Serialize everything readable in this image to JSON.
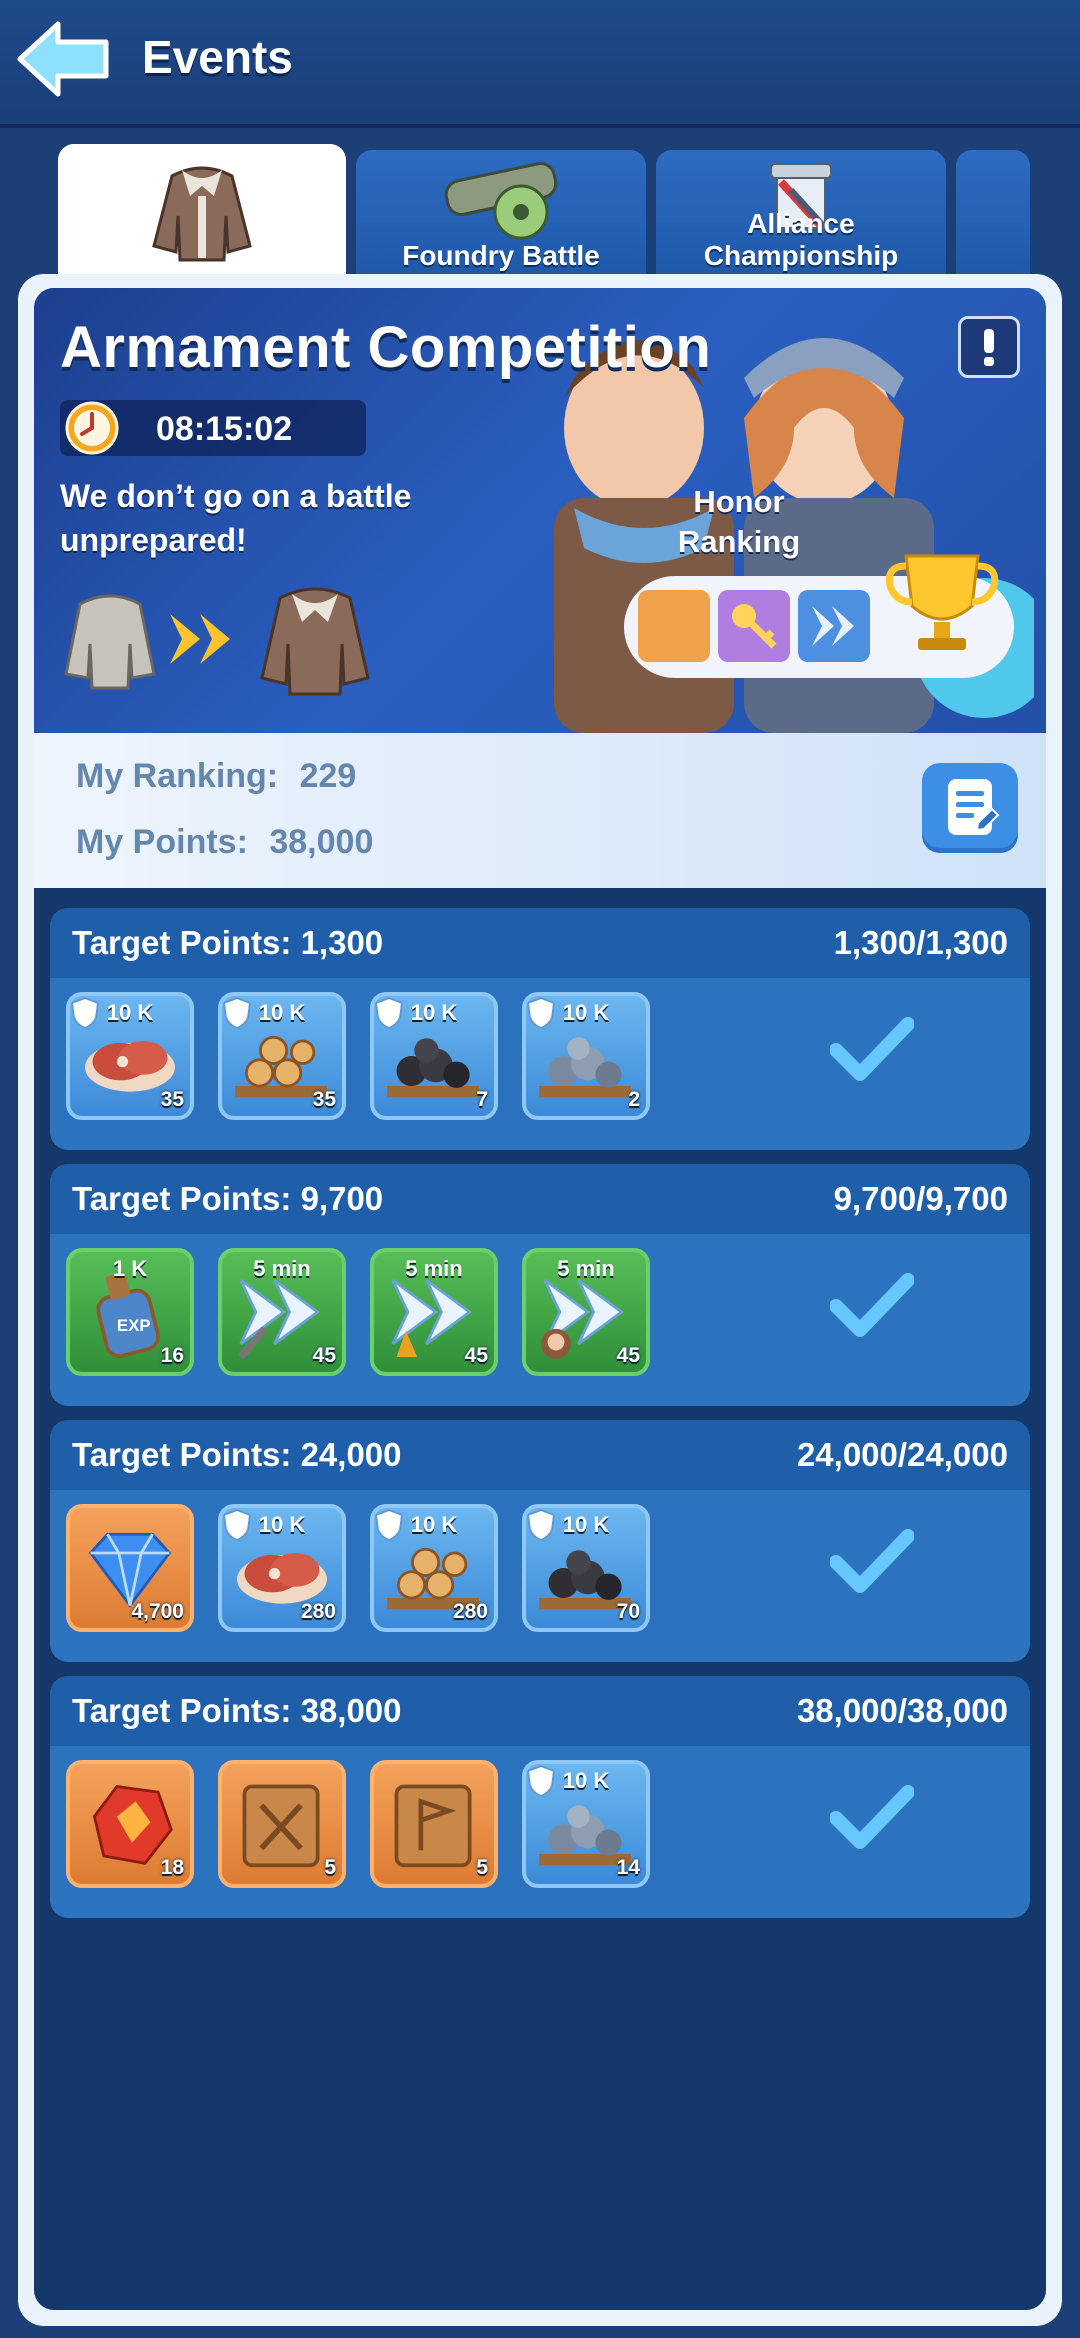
{
  "header": {
    "title": "Events",
    "back_icon": "back-arrow-icon"
  },
  "tabs": [
    {
      "label": "",
      "icon": "fur-coat-icon",
      "active": true
    },
    {
      "label": "Foundry Battle",
      "icon": "cannon-icon",
      "active": false
    },
    {
      "label": "Alliance Championship",
      "icon": "sword-banner-icon",
      "active": false
    },
    {
      "label": "",
      "icon": "",
      "active": false
    }
  ],
  "banner": {
    "title": "Armament Competition",
    "timer": "08:15:02",
    "tagline": "We don’t go on a battle unprepared!",
    "honor_label": "Honor Ranking",
    "info_icon": "exclamation-icon"
  },
  "ranking": {
    "rank_label": "My Ranking:",
    "rank_value": "229",
    "points_label": "My Points:",
    "points_value": "38,000"
  },
  "targets": [
    {
      "title": "Target Points: 1,300",
      "progress": "1,300/1,300",
      "items": [
        {
          "type": "meat",
          "top": "10 K",
          "qty": "35",
          "frame": "blue"
        },
        {
          "type": "wood",
          "top": "10 K",
          "qty": "35",
          "frame": "blue"
        },
        {
          "type": "coal",
          "top": "10 K",
          "qty": "7",
          "frame": "blue"
        },
        {
          "type": "iron",
          "top": "10 K",
          "qty": "2",
          "frame": "blue"
        }
      ]
    },
    {
      "title": "Target Points: 9,700",
      "progress": "9,700/9,700",
      "items": [
        {
          "type": "exp-potion",
          "top": "1 K",
          "qty": "16",
          "frame": "green"
        },
        {
          "type": "speedup-hammer",
          "top": "5 min",
          "qty": "45",
          "frame": "green"
        },
        {
          "type": "speedup-flask",
          "top": "5 min",
          "qty": "45",
          "frame": "green"
        },
        {
          "type": "speedup-hero",
          "top": "5 min",
          "qty": "45",
          "frame": "green"
        }
      ]
    },
    {
      "title": "Target Points: 24,000",
      "progress": "24,000/24,000",
      "items": [
        {
          "type": "gem",
          "top": "",
          "qty": "4,700",
          "frame": "orange"
        },
        {
          "type": "meat",
          "top": "10 K",
          "qty": "280",
          "frame": "blue"
        },
        {
          "type": "wood",
          "top": "10 K",
          "qty": "280",
          "frame": "blue"
        },
        {
          "type": "coal",
          "top": "10 K",
          "qty": "70",
          "frame": "blue"
        }
      ]
    },
    {
      "title": "Target Points: 38,000",
      "progress": "38,000/38,000",
      "items": [
        {
          "type": "fire-crystal",
          "top": "",
          "qty": "18",
          "frame": "orange"
        },
        {
          "type": "tome-swords",
          "top": "",
          "qty": "5",
          "frame": "orange"
        },
        {
          "type": "tome-flag",
          "top": "",
          "qty": "5",
          "frame": "orange"
        },
        {
          "type": "iron",
          "top": "10 K",
          "qty": "14",
          "frame": "blue"
        }
      ]
    }
  ],
  "colors": {
    "accent": "#2c73bf",
    "check": "#66c8ff",
    "frame_blue": "#8fc8f5",
    "frame_green": "#6ad06a",
    "frame_orange": "#ffb26e"
  }
}
